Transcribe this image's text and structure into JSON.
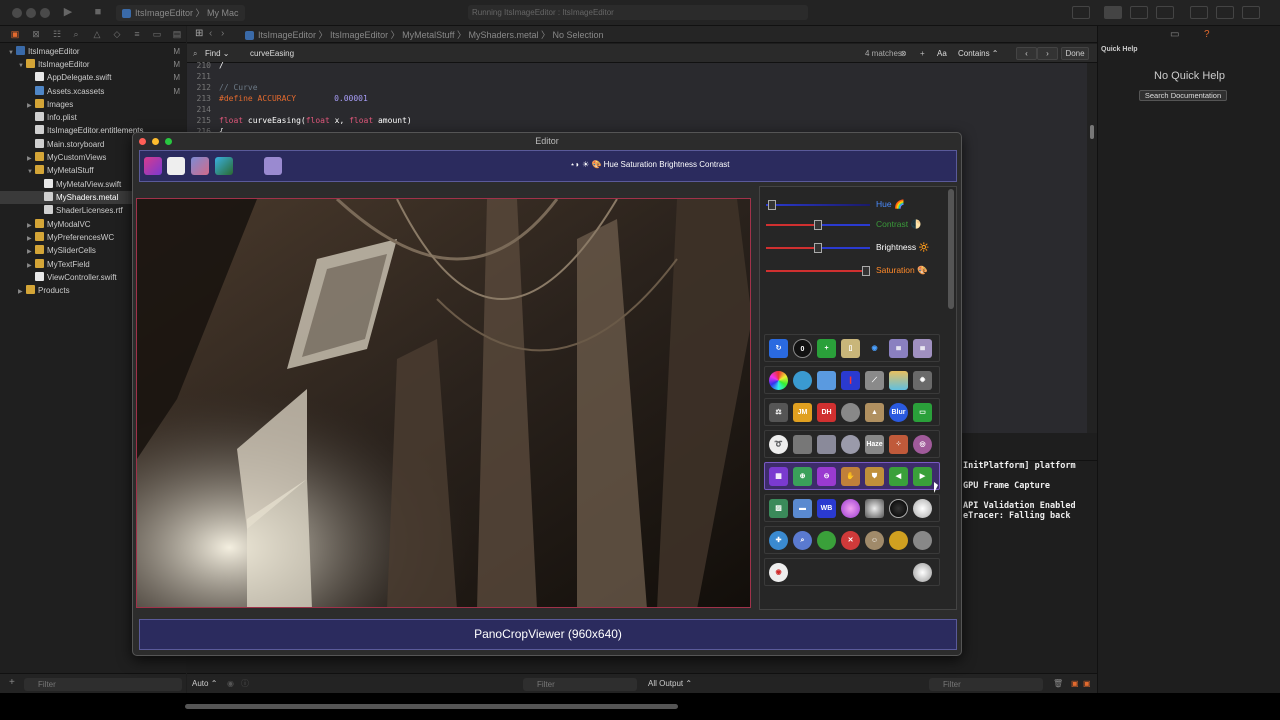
{
  "window": {
    "scheme": "ItsImageEditor",
    "destination": "My Mac",
    "status": "Running ItsImageEditor : ItsImageEditor"
  },
  "jumpbar": [
    "ItsImageEditor",
    "ItsImageEditor",
    "MyMetalStuff",
    "MyShaders.metal",
    "No Selection"
  ],
  "find": {
    "mode": "Find",
    "query": "curveEasing",
    "matches": "4 matches",
    "case_btn": "Aa",
    "match_type": "Contains",
    "done": "Done"
  },
  "navigator": {
    "items": [
      {
        "label": "ItsImageEditor",
        "badge": "M",
        "icon": "project-icon"
      },
      {
        "label": "ItsImageEditor",
        "badge": "M",
        "icon": "folder-icon"
      },
      {
        "label": "AppDelegate.swift",
        "badge": "M",
        "icon": "swift-file-icon"
      },
      {
        "label": "Assets.xcassets",
        "badge": "M",
        "icon": "assets-icon"
      },
      {
        "label": "Images",
        "badge": "",
        "icon": "folder-icon"
      },
      {
        "label": "Info.plist",
        "badge": "",
        "icon": "plist-icon"
      },
      {
        "label": "ItsImageEditor.entitlements",
        "badge": "",
        "icon": "file-icon"
      },
      {
        "label": "Main.storyboard",
        "badge": "",
        "icon": "storyboard-icon"
      },
      {
        "label": "MyCustomViews",
        "badge": "",
        "icon": "folder-icon"
      },
      {
        "label": "MyMetalStuff",
        "badge": "",
        "icon": "folder-icon"
      },
      {
        "label": "MyMetalView.swift",
        "badge": "",
        "icon": "swift-file-icon"
      },
      {
        "label": "MyShaders.metal",
        "badge": "",
        "icon": "metal-file-icon"
      },
      {
        "label": "ShaderLicenses.rtf",
        "badge": "",
        "icon": "file-icon"
      },
      {
        "label": "MyModalVC",
        "badge": "",
        "icon": "folder-icon"
      },
      {
        "label": "MyPreferencesWC",
        "badge": "",
        "icon": "folder-icon"
      },
      {
        "label": "MySliderCells",
        "badge": "",
        "icon": "folder-icon"
      },
      {
        "label": "MyTextField",
        "badge": "",
        "icon": "folder-icon"
      },
      {
        "label": "ViewController.swift",
        "badge": "",
        "icon": "swift-file-icon"
      },
      {
        "label": "Products",
        "badge": "",
        "icon": "folder-icon"
      }
    ],
    "filter_placeholder": "Filter"
  },
  "code": {
    "lines": [
      {
        "n": "210",
        "text": "/"
      },
      {
        "n": "211",
        "text": ""
      },
      {
        "n": "212",
        "comment": "// Curve"
      },
      {
        "n": "213",
        "pp": "#define ACCURACY",
        "num": "0.00001"
      },
      {
        "n": "214",
        "text": ""
      },
      {
        "n": "215",
        "kw1": "float",
        "fn": " curveEasing(",
        "kw2": "float",
        "a": " x, ",
        "kw3": "float",
        "b": " amount)"
      },
      {
        "n": "216",
        "text": "{"
      }
    ]
  },
  "console": {
    "lines": [
      "InitPlatform] platform",
      "GPU Frame Capture",
      "API Validation Enabled",
      "eTracer: Falling back"
    ]
  },
  "bottombar": {
    "auto": "Auto",
    "filter": "Filter",
    "output": "All Output",
    "filter2": "Filter"
  },
  "quick_help": {
    "title": "Quick Help",
    "empty": "No Quick Help",
    "search_btn": "Search Documentation"
  },
  "editor": {
    "title": "Editor",
    "header_text": "Hue Saturation Brightness Contrast",
    "footer": "PanoCropViewer (960x640)",
    "sliders": [
      {
        "label": "Hue 🌈",
        "color": "#4a8cff",
        "level": 0.02
      },
      {
        "label": "Contrast 🌓",
        "color": "#3a9a3a",
        "level": 0.5
      },
      {
        "label": "Brightness 🔆",
        "color": "#ffffff",
        "level": 0.5
      },
      {
        "label": "Saturation 🎨",
        "color": "#ff8a2a",
        "level": 0.96
      }
    ],
    "icon_rows": [
      [
        "refresh",
        "0",
        "add",
        "battery",
        "eye",
        "stack",
        "stack2"
      ],
      [
        "color-wheel",
        "lens",
        "bubble",
        "thermometer",
        "brush",
        "bars",
        "gear"
      ],
      [
        "scales",
        "JM",
        "DH",
        "ball",
        "cone",
        "blur",
        "window"
      ],
      [
        "swirl",
        "emboss",
        "crystal",
        "sphere",
        "Haze",
        "dots",
        "ring"
      ],
      [
        "slideshow",
        "zoom-plus",
        "zoom-minus",
        "hand",
        "shield",
        "arrow-left",
        "arrow-right"
      ],
      [
        "picture",
        "landscape",
        "WB",
        "orb",
        "vignette",
        "dark-orb",
        "light-orb"
      ],
      [
        "crosshair",
        "magnifier",
        "sphere-green",
        "pinch",
        "face",
        "gold",
        "stone"
      ],
      [
        "red-eye",
        "white-orb"
      ]
    ]
  }
}
